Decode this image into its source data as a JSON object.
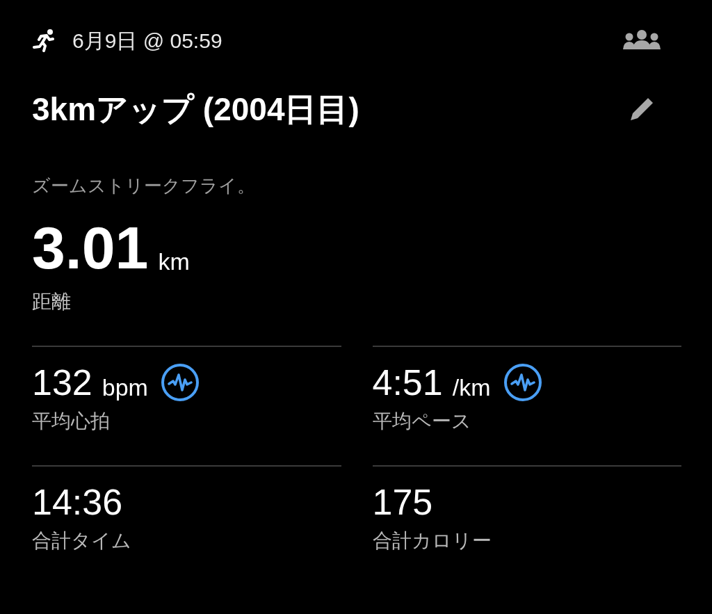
{
  "header": {
    "date": "6月9日 @ 05:59"
  },
  "title": "3kmアップ (2004日目)",
  "description": "ズームストリークフライ。",
  "distance": {
    "value": "3.01",
    "unit": "km",
    "label": "距離"
  },
  "stats": [
    {
      "value": "132",
      "unit": "bpm",
      "label": "平均心拍",
      "graph_icon": true
    },
    {
      "value": "4:51",
      "unit": "/km",
      "label": "平均ペース",
      "graph_icon": true
    },
    {
      "value": "14:36",
      "label": "合計タイム",
      "graph_icon": false
    },
    {
      "value": "175",
      "label": "合計カロリー",
      "graph_icon": false
    }
  ]
}
